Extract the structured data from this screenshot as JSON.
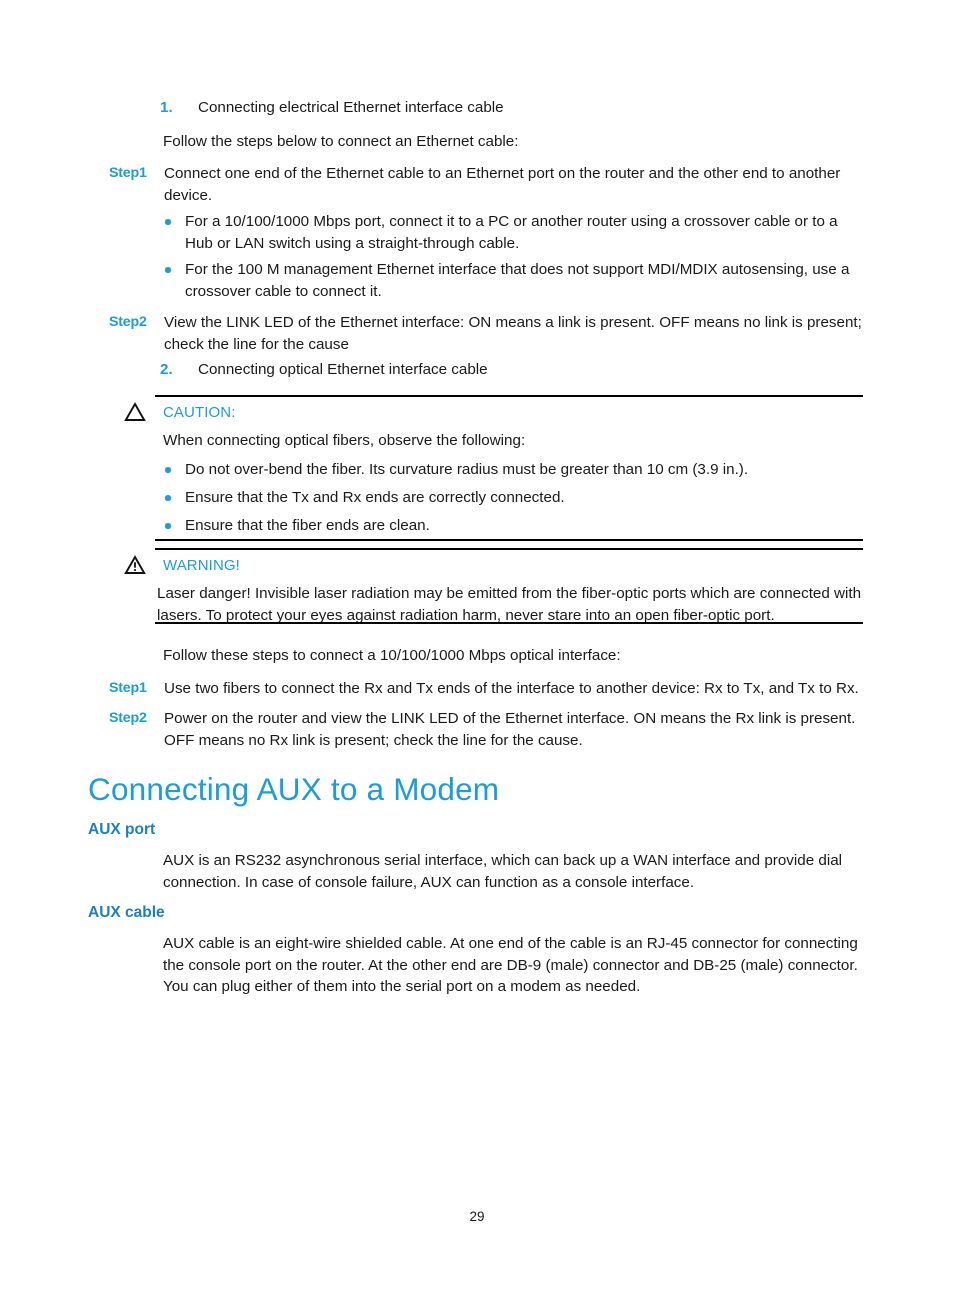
{
  "document": {
    "page_number": "29"
  },
  "section_electrical": {
    "number": "1.",
    "title": "Connecting electrical Ethernet interface cable",
    "intro": "Follow the steps below to connect an Ethernet cable:",
    "steps": [
      {
        "label": "Step1",
        "text": "Connect one end of the Ethernet cable to an Ethernet port on the router and the other end to another device."
      },
      {
        "label": "Step2",
        "text": "View the LINK LED of the Ethernet interface: ON means a link is present. OFF means no link is present; check the line for the cause"
      }
    ],
    "bullets": [
      "For a 10/100/1000 Mbps port, connect it to a PC or another router using a crossover cable or to a Hub or LAN switch using a straight-through cable.",
      "For the 100 M management Ethernet interface that does not support MDI/MDIX autosensing, use a crossover cable to connect it."
    ]
  },
  "section_optical": {
    "number": "2.",
    "title": "Connecting optical Ethernet interface cable",
    "intro": "Follow these steps to connect a 10/100/1000 Mbps optical interface:",
    "steps": [
      {
        "label": "Step1",
        "text": "Use two fibers to connect the Rx and Tx ends of the interface to another device: Rx to Tx, and Tx to Rx."
      },
      {
        "label": "Step2",
        "text": "Power on the router and view the LINK LED of the Ethernet interface. ON means the Rx link is present. OFF means no Rx link is present; check the line for the cause."
      }
    ]
  },
  "caution": {
    "icon": "caution-triangle-icon",
    "title": "CAUTION:",
    "intro": "When connecting optical fibers, observe the following:",
    "bullets": [
      "Do not over-bend the fiber. Its curvature radius must be greater than 10 cm (3.9 in.).",
      "Ensure that the Tx and Rx ends are correctly connected.",
      "Ensure that the fiber ends are clean."
    ]
  },
  "warning": {
    "icon": "warning-triangle-icon",
    "title": "WARNING!",
    "text": "Laser danger! Invisible laser radiation may be emitted from the fiber-optic ports which are connected with lasers. To protect your eyes against radiation harm, never stare into an open fiber-optic port."
  },
  "aux_section": {
    "heading": "Connecting AUX to a Modem",
    "port": {
      "heading": "AUX port",
      "text": "AUX is an RS232 asynchronous serial interface, which can back up a WAN interface and provide dial connection. In case of console failure, AUX can function as a console interface."
    },
    "cable": {
      "heading": "AUX cable",
      "text": "AUX cable is an eight-wire shielded cable. At one end of the cable is an RJ-45 connector for connecting the console port on the router. At the other end are DB-9 (male) connector and DB-25 (male) connector. You can plug either of them into the serial port on a modem as needed."
    }
  },
  "colors": {
    "accent_blue": "#1b9dd9",
    "heading_blue": "#1b7fc0",
    "text_black": "#1a1a1a",
    "rule_black": "#000000"
  }
}
